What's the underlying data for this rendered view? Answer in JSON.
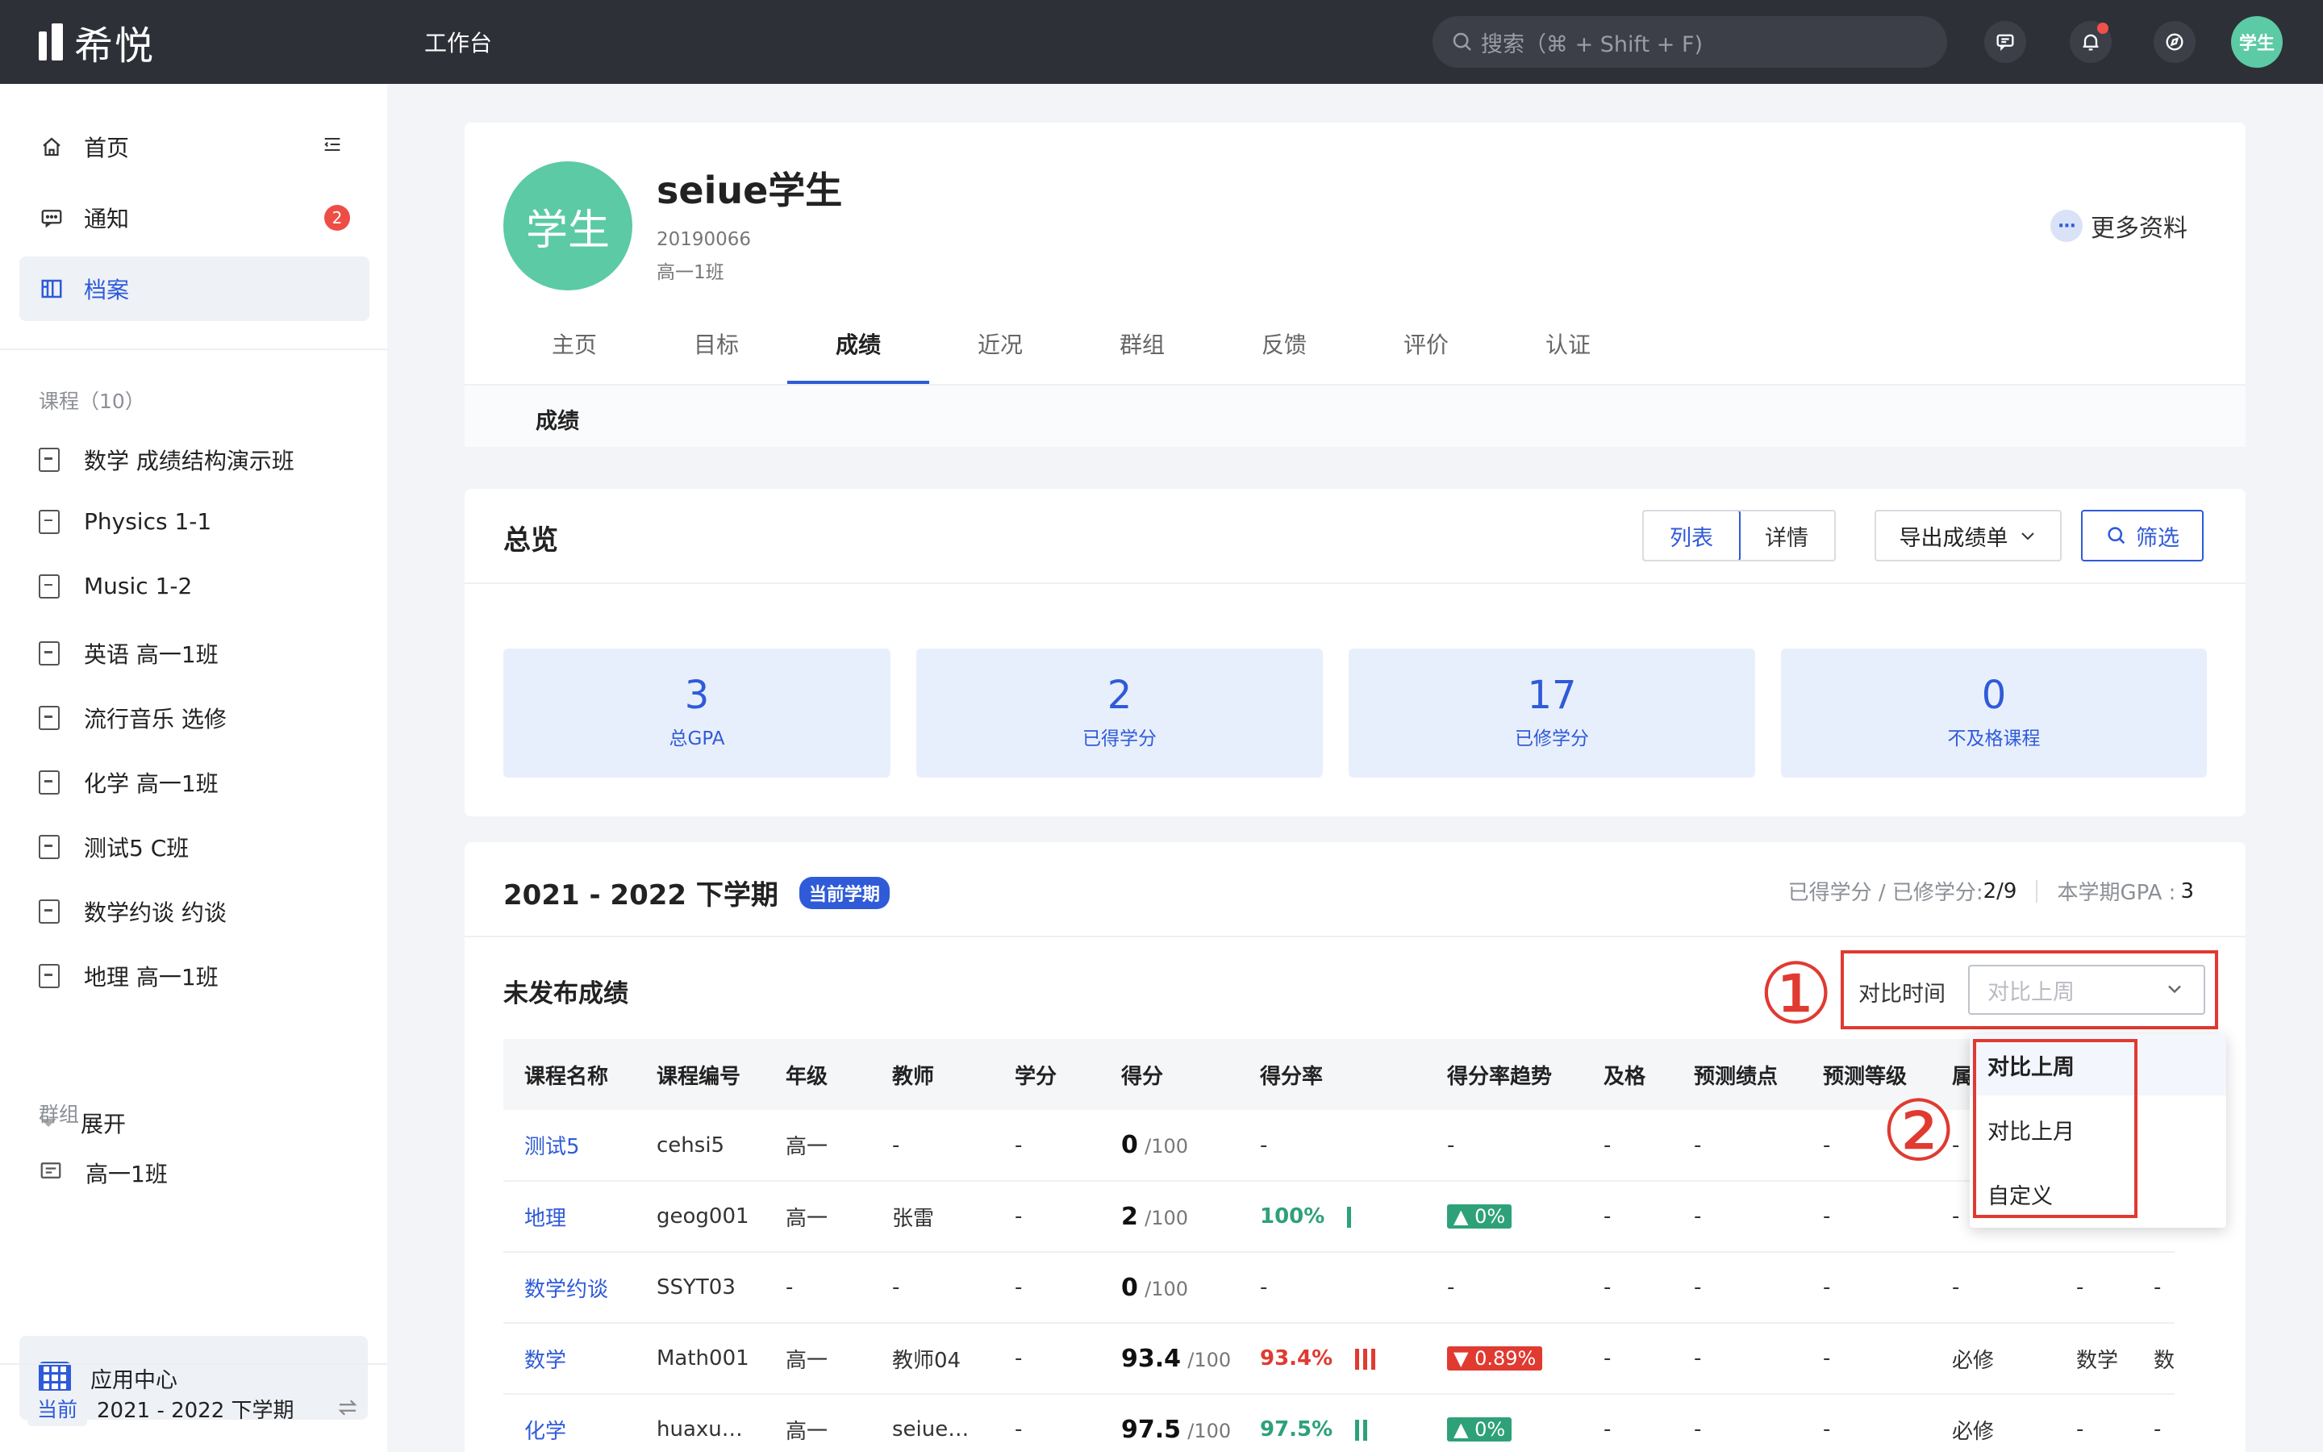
{
  "app": {
    "name": "希悦",
    "workbench": "工作台"
  },
  "search": {
    "placeholder": "搜索（⌘ + Shift + F)"
  },
  "user": {
    "avatar_label": "学生"
  },
  "sidebar": {
    "nav": [
      {
        "label": "首页",
        "icon": "home-icon"
      },
      {
        "label": "通知",
        "icon": "message-icon",
        "badge": "2"
      },
      {
        "label": "档案",
        "icon": "archive-icon",
        "active": true
      }
    ],
    "courses_title": "课程（10）",
    "courses": [
      "数学 成绩结构演示班",
      "Physics 1-1",
      "Music 1-2",
      "英语 高一1班",
      "流行音乐 选修",
      "化学 高一1班",
      "测试5 C班",
      "数学约谈 约谈",
      "地理 高一1班"
    ],
    "expand_label": "展开",
    "groups_title": "群组",
    "groups": [
      "高一1班"
    ],
    "app_center": "应用中心",
    "term_tag": "当前",
    "term_label": "2021 - 2022 下学期"
  },
  "profile": {
    "avatar_text": "学生",
    "name": "seiue学生",
    "student_id": "20190066",
    "class": "高一1班",
    "more_info": "更多资料",
    "tabs": [
      "主页",
      "目标",
      "成绩",
      "近况",
      "群组",
      "反馈",
      "评价",
      "认证"
    ],
    "active_tab": "成绩",
    "subtab": "成绩"
  },
  "overview": {
    "title": "总览",
    "view_list": "列表",
    "view_detail": "详情",
    "export": "导出成绩单",
    "filter": "筛选",
    "stats": [
      {
        "value": "3",
        "label": "总GPA"
      },
      {
        "value": "2",
        "label": "已得学分"
      },
      {
        "value": "17",
        "label": "已修学分"
      },
      {
        "value": "0",
        "label": "不及格课程"
      }
    ]
  },
  "term": {
    "title": "2021 - 2022 下学期",
    "badge": "当前学期",
    "credits_label": "已得学分 / 已修学分:",
    "credits_value": "2/9",
    "gpa_label": "本学期GPA :",
    "gpa_value": "3",
    "unpublished": "未发布成绩",
    "compare_label": "对比时间",
    "compare_placeholder": "对比上周",
    "annotation_1": "①",
    "annotation_2": "②",
    "dropdown_options": [
      "对比上周",
      "对比上月",
      "自定义"
    ],
    "columns": [
      "课程名称",
      "课程编号",
      "年级",
      "教师",
      "学分",
      "得分",
      "得分率",
      "得分率趋势",
      "及格",
      "预测绩点",
      "预测等级",
      "属"
    ],
    "rows": [
      {
        "course": "测试5",
        "code": "cehsi5",
        "grade": "高一",
        "teacher": "-",
        "credit": "-",
        "score": "0",
        "max": "/100",
        "rate": "-",
        "trend": "-",
        "pass": "-",
        "gp": "-",
        "level": "-",
        "attr": "-",
        "extra1": "",
        "extra2": ""
      },
      {
        "course": "地理",
        "code": "geog001",
        "grade": "高一",
        "teacher": "张雷",
        "credit": "-",
        "score": "2",
        "max": "/100",
        "rate": "100%",
        "trend": "0%",
        "pass": "-",
        "gp": "-",
        "level": "-",
        "attr": "-",
        "extra1": "",
        "extra2": ""
      },
      {
        "course": "数学约谈",
        "code": "SSYT03",
        "grade": "-",
        "teacher": "-",
        "credit": "-",
        "score": "0",
        "max": "/100",
        "rate": "-",
        "trend": "-",
        "pass": "-",
        "gp": "-",
        "level": "-",
        "attr": "-",
        "extra1": "-",
        "extra2": "-"
      },
      {
        "course": "数学",
        "code": "Math001",
        "grade": "高一",
        "teacher": "教师04",
        "credit": "-",
        "score": "93.4",
        "max": "/100",
        "rate": "93.4%",
        "trend": "0.89%",
        "pass": "-",
        "gp": "-",
        "level": "-",
        "attr": "必修",
        "extra1": "数学",
        "extra2": "数"
      },
      {
        "course": "化学",
        "code": "huaxu…",
        "grade": "高一",
        "teacher": "seiue…",
        "credit": "-",
        "score": "97.5",
        "max": "/100",
        "rate": "97.5%",
        "trend": "0%",
        "pass": "-",
        "gp": "-",
        "level": "-",
        "attr": "必修",
        "extra1": "-",
        "extra2": "-"
      }
    ]
  },
  "colors": {
    "accent": "#2f5bd8",
    "success": "#2ea178",
    "danger": "#e03a31",
    "topbar": "#2e3038",
    "avatar": "#5ccaa4"
  }
}
